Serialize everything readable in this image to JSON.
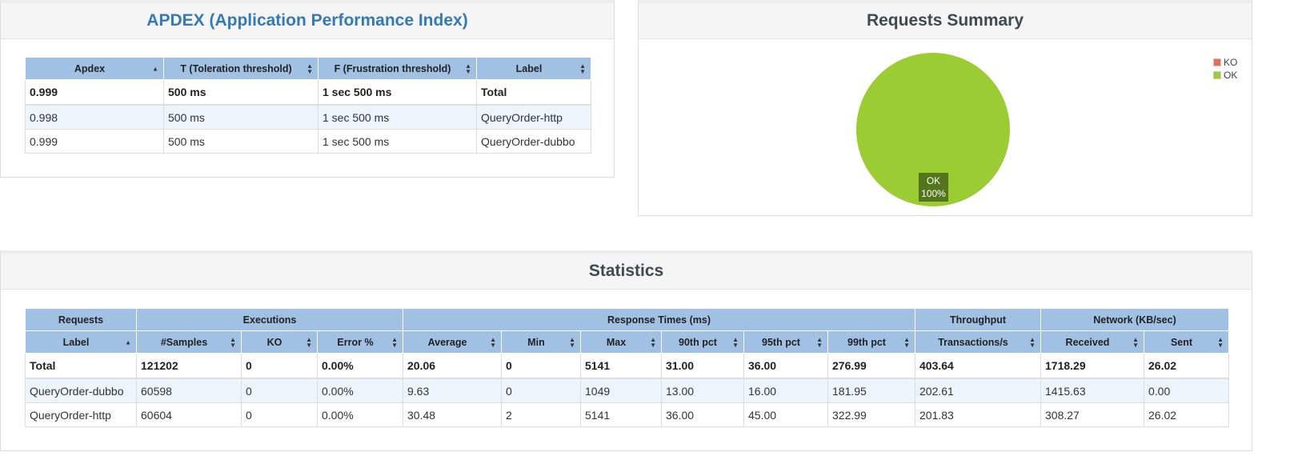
{
  "apdex": {
    "title": "APDEX (Application Performance Index)",
    "headers": [
      "Apdex",
      "T (Toleration threshold)",
      "F (Frustration threshold)",
      "Label"
    ],
    "rows": [
      [
        "0.999",
        "500 ms",
        "1 sec 500 ms",
        "Total"
      ],
      [
        "0.998",
        "500 ms",
        "1 sec 500 ms",
        "QueryOrder-http"
      ],
      [
        "0.999",
        "500 ms",
        "1 sec 500 ms",
        "QueryOrder-dubbo"
      ]
    ]
  },
  "summary": {
    "title": "Requests Summary",
    "legend": [
      {
        "label": "KO",
        "color": "#ef6a55"
      },
      {
        "label": "OK",
        "color": "#9ccc33"
      }
    ],
    "slice_label": "OK",
    "slice_percent": "100%",
    "chart_data": {
      "type": "pie",
      "categories": [
        "KO",
        "OK"
      ],
      "values": [
        0,
        100
      ],
      "legend_position": "top-right"
    }
  },
  "statistics": {
    "title": "Statistics",
    "groups": [
      "Requests",
      "Executions",
      "Response Times (ms)",
      "Throughput",
      "Network (KB/sec)"
    ],
    "headers": [
      "Label",
      "#Samples",
      "KO",
      "Error %",
      "Average",
      "Min",
      "Max",
      "90th pct",
      "95th pct",
      "99th pct",
      "Transactions/s",
      "Received",
      "Sent"
    ],
    "rows": [
      [
        "Total",
        "121202",
        "0",
        "0.00%",
        "20.06",
        "0",
        "5141",
        "31.00",
        "36.00",
        "276.99",
        "403.64",
        "1718.29",
        "26.02"
      ],
      [
        "QueryOrder-dubbo",
        "60598",
        "0",
        "0.00%",
        "9.63",
        "0",
        "1049",
        "13.00",
        "16.00",
        "181.95",
        "202.61",
        "1415.63",
        "0.00"
      ],
      [
        "QueryOrder-http",
        "60604",
        "0",
        "0.00%",
        "30.48",
        "2",
        "5141",
        "36.00",
        "45.00",
        "322.99",
        "201.83",
        "308.27",
        "26.02"
      ]
    ]
  }
}
